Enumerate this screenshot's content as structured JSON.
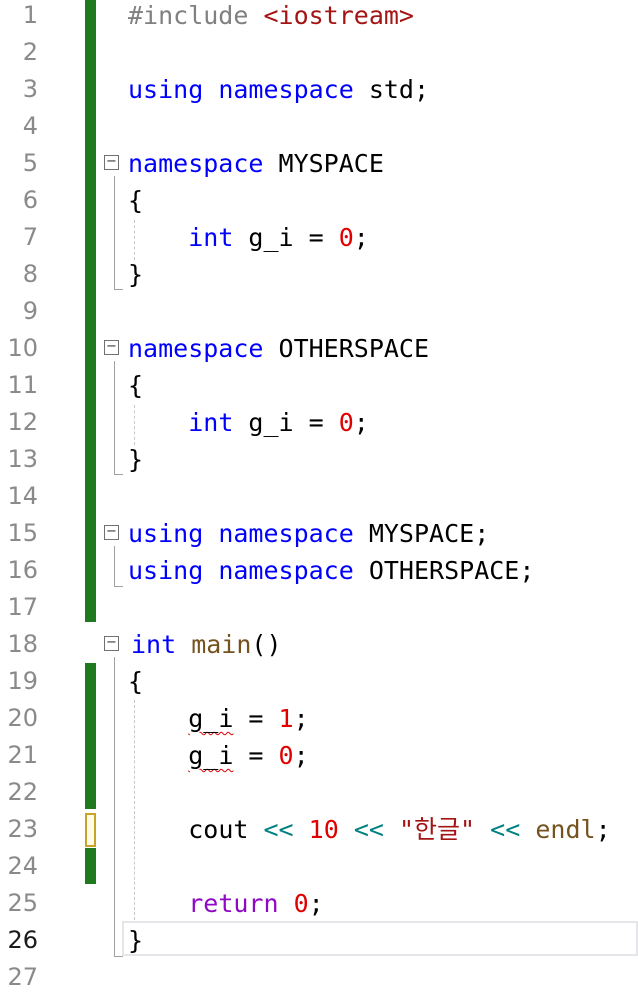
{
  "editor": {
    "line_numbers": [
      "1",
      "2",
      "3",
      "4",
      "5",
      "6",
      "7",
      "8",
      "9",
      "10",
      "11",
      "12",
      "13",
      "14",
      "15",
      "16",
      "17",
      "18",
      "19",
      "20",
      "21",
      "22",
      "23",
      "24",
      "25",
      "26",
      "27"
    ],
    "current_line": "26",
    "line1": {
      "directive": "#include ",
      "header": "<iostream>"
    },
    "line3": {
      "kw1": "using",
      "kw2": " namespace",
      "rest": " std;"
    },
    "line5": {
      "kw": "namespace",
      "name": " MYSPACE"
    },
    "line6": {
      "text": "{"
    },
    "line7": {
      "indent": "    ",
      "kw": "int",
      "mid": " g_i = ",
      "num": "0",
      "end": ";"
    },
    "line8": {
      "text": "}"
    },
    "line10": {
      "kw": "namespace",
      "name": " OTHERSPACE"
    },
    "line11": {
      "text": "{"
    },
    "line12": {
      "indent": "    ",
      "kw": "int",
      "mid": " g_i = ",
      "num": "0",
      "end": ";"
    },
    "line13": {
      "text": "}"
    },
    "line15": {
      "kw1": "using",
      "kw2": " namespace",
      "rest": " MYSPACE;"
    },
    "line16": {
      "kw1": "using",
      "kw2": " namespace",
      "rest": " OTHERSPACE;"
    },
    "line18": {
      "kw": "int",
      "fn": " main",
      "rest": "()"
    },
    "line19": {
      "text": "{"
    },
    "line20": {
      "indent": "    ",
      "var": "g_i",
      "mid": " = ",
      "num": "1",
      "end": ";"
    },
    "line21": {
      "indent": "    ",
      "var": "g_i",
      "mid": " = ",
      "num": "0",
      "end": ";"
    },
    "line23": {
      "indent": "    ",
      "cout": "cout ",
      "op1": "<<",
      "sp1": " ",
      "num": "10",
      "sp2": " ",
      "op2": "<<",
      "sp3": " ",
      "str": "\"한글\"",
      "sp4": " ",
      "op3": "<<",
      "sp5": " ",
      "endl": "endl",
      "end": ";"
    },
    "line25": {
      "indent": "    ",
      "kw": "return",
      "sp": " ",
      "num": "0",
      "end": ";"
    },
    "line26": {
      "text": "}"
    }
  },
  "colors": {
    "keyword": "#0000ff",
    "string": "#a31515",
    "number": "#e00000",
    "function": "#74531f",
    "operator": "#008080",
    "control": "#8f08c4",
    "change_bar": "#1f7a1f",
    "unsaved_marker": "#c9a227"
  }
}
